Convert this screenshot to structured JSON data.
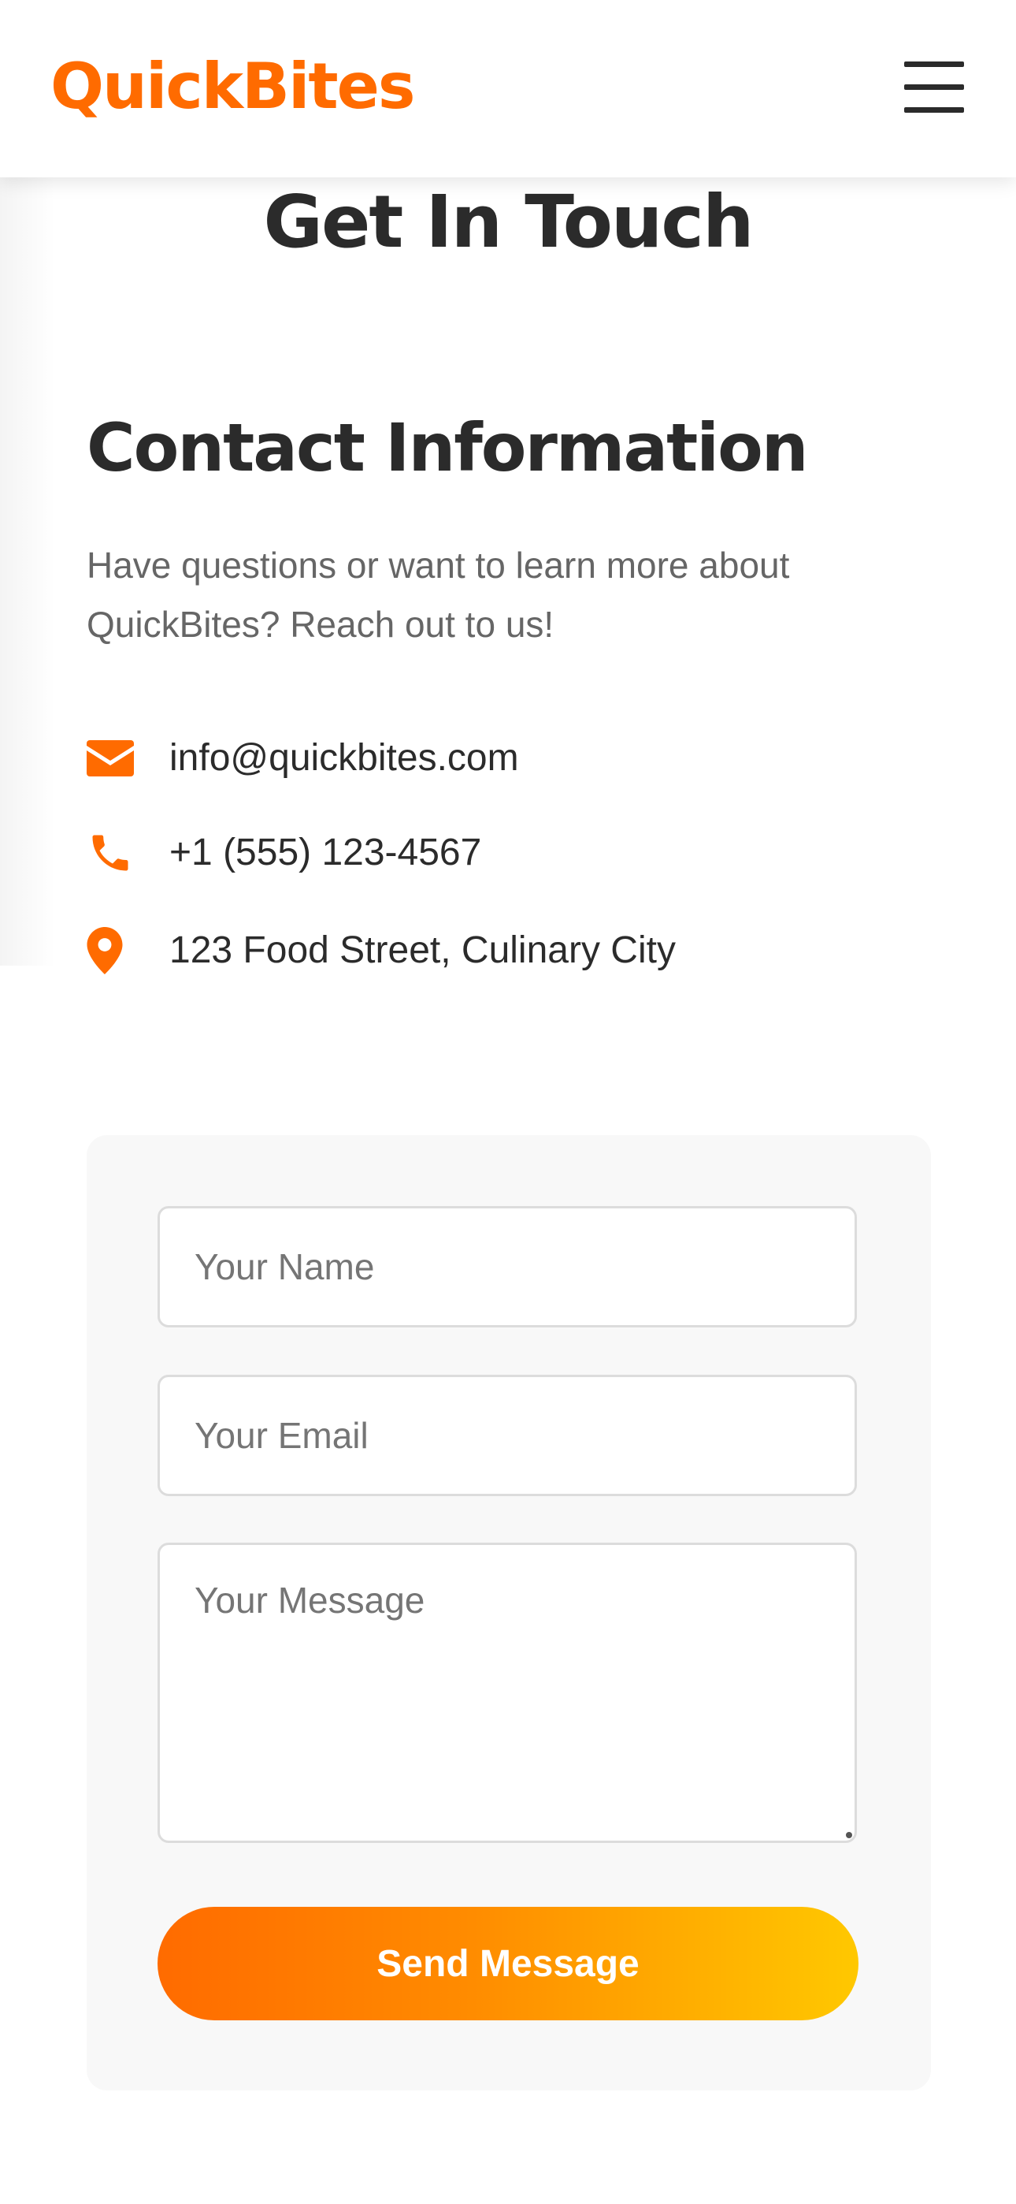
{
  "header": {
    "logo": "QuickBites",
    "menu_icon": "hamburger-menu-icon"
  },
  "page": {
    "title": "Get In Touch"
  },
  "contact": {
    "heading": "Contact Information",
    "description": "Have questions or want to learn more about QuickBites? Reach out to us!",
    "items": [
      {
        "icon": "envelope-icon",
        "text": "info@quickbites.com"
      },
      {
        "icon": "phone-icon",
        "text": "+1 (555) 123-4567"
      },
      {
        "icon": "map-pin-icon",
        "text": "123 Food Street, Culinary City"
      }
    ]
  },
  "form": {
    "name_placeholder": "Your Name",
    "email_placeholder": "Your Email",
    "message_placeholder": "Your Message",
    "name_value": "",
    "email_value": "",
    "message_value": "",
    "submit_label": "Send Message"
  },
  "colors": {
    "brand": "#ff6b00",
    "gradient_end": "#ffc800",
    "text_dark": "#2b2b2b",
    "text_muted": "#666666",
    "card_bg": "#f8f8f8"
  }
}
